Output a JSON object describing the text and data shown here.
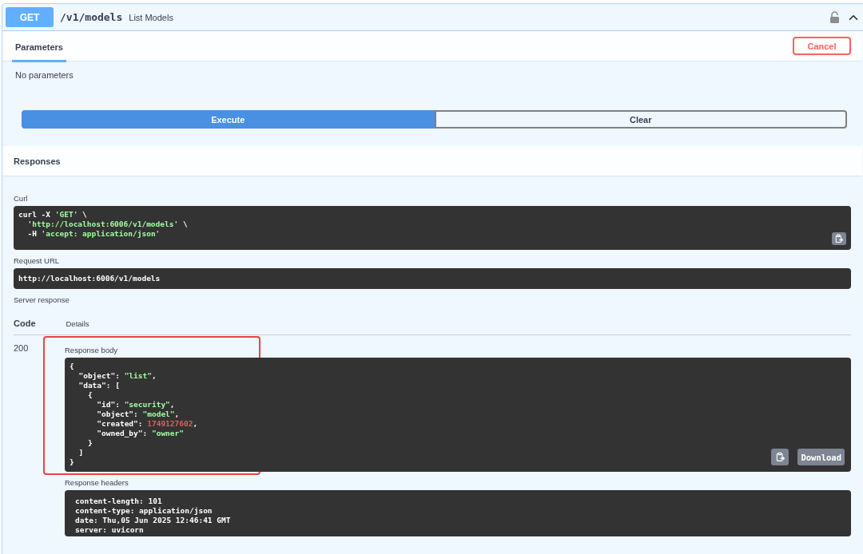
{
  "operation": {
    "method": "GET",
    "path": "/v1/models",
    "summary": "List Models",
    "locked": false,
    "expanded": true
  },
  "tabs": [
    {
      "label": "Parameters",
      "selected": true
    }
  ],
  "cancel_button": "Cancel",
  "parameters_text": "No parameters",
  "buttons": [
    {
      "label": "Execute",
      "kind": "primary"
    },
    {
      "label": "Clear",
      "kind": "secondary"
    }
  ],
  "responses_title": "Responses",
  "curl": {
    "label": "Curl",
    "lines": [
      [
        {
          "text": "curl -X ",
          "kind": "plain"
        },
        {
          "text": "'GET'",
          "kind": "string"
        },
        {
          "text": " \\",
          "kind": "plain"
        }
      ],
      [
        {
          "text": "  'http://localhost:6006/v1/models'",
          "kind": "string"
        },
        {
          "text": " \\",
          "kind": "plain"
        }
      ],
      [
        {
          "text": "  -H ",
          "kind": "plain"
        },
        {
          "text": "'accept: application/json'",
          "kind": "string"
        }
      ]
    ]
  },
  "request_url": {
    "label": "Request URL",
    "value": "http://localhost:6006/v1/models"
  },
  "server_response": {
    "label": "Server response",
    "columns": [
      "Code",
      "Details"
    ],
    "code": "200",
    "body_label": "Response body",
    "body_lines": [
      [
        {
          "text": "{",
          "kind": "plain"
        }
      ],
      [
        {
          "text": "  \"object\": ",
          "kind": "plain"
        },
        {
          "text": "\"list\"",
          "kind": "string"
        },
        {
          "text": ",",
          "kind": "plain"
        }
      ],
      [
        {
          "text": "  \"data\": [",
          "kind": "plain"
        }
      ],
      [
        {
          "text": "    {",
          "kind": "plain"
        }
      ],
      [
        {
          "text": "      \"id\": ",
          "kind": "plain"
        },
        {
          "text": "\"security\"",
          "kind": "string"
        },
        {
          "text": ",",
          "kind": "plain"
        }
      ],
      [
        {
          "text": "      \"object\": ",
          "kind": "plain"
        },
        {
          "text": "\"model\"",
          "kind": "string"
        },
        {
          "text": ",",
          "kind": "plain"
        }
      ],
      [
        {
          "text": "      \"created\": ",
          "kind": "plain"
        },
        {
          "text": "1749127602",
          "kind": "number"
        },
        {
          "text": ",",
          "kind": "plain"
        }
      ],
      [
        {
          "text": "      \"owned_by\": ",
          "kind": "plain"
        },
        {
          "text": "\"owner\"",
          "kind": "string"
        }
      ],
      [
        {
          "text": "    }",
          "kind": "plain"
        }
      ],
      [
        {
          "text": "  ]",
          "kind": "plain"
        }
      ],
      [
        {
          "text": "}",
          "kind": "plain"
        }
      ]
    ],
    "download_button": "Download",
    "headers_label": "Response headers",
    "headers_lines": [
      "content-length: 101",
      "content-type: application/json",
      "date: Thu,05 Jun 2025 12:46:41 GMT",
      "server: uvicorn"
    ]
  }
}
